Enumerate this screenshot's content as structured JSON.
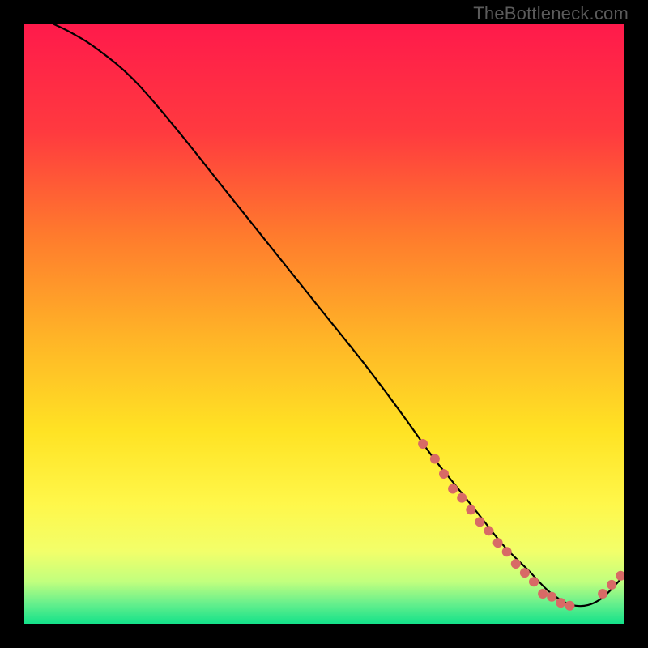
{
  "watermark": "TheBottleneck.com",
  "chart_data": {
    "type": "line",
    "title": "",
    "xlabel": "",
    "ylabel": "",
    "xlim": [
      0,
      100
    ],
    "ylim": [
      0,
      100
    ],
    "series": [
      {
        "name": "curve",
        "x": [
          5,
          8,
          12,
          18,
          25,
          33,
          41,
          49,
          57,
          63,
          68,
          72,
          76,
          80,
          84,
          88,
          92,
          96,
          100
        ],
        "y": [
          100,
          98.5,
          96,
          91,
          83,
          73,
          63,
          53,
          43,
          35,
          28,
          23,
          18,
          13,
          9,
          5,
          3,
          4,
          8
        ]
      }
    ],
    "markers": {
      "name": "dots",
      "x": [
        66.5,
        68.5,
        70,
        71.5,
        73,
        74.5,
        76,
        77.5,
        79,
        80.5,
        82,
        83.5,
        85,
        86.5,
        88,
        89.5,
        91,
        96.5,
        98,
        99.5
      ],
      "y": [
        30,
        27.5,
        25,
        22.5,
        21,
        19,
        17,
        15.5,
        13.5,
        12,
        10,
        8.5,
        7,
        5,
        4.5,
        3.5,
        3,
        5,
        6.5,
        8
      ]
    },
    "gradient_stops": [
      {
        "offset": 0.0,
        "color": "#ff1a4b"
      },
      {
        "offset": 0.18,
        "color": "#ff3a3f"
      },
      {
        "offset": 0.35,
        "color": "#ff7a2d"
      },
      {
        "offset": 0.52,
        "color": "#ffb327"
      },
      {
        "offset": 0.68,
        "color": "#ffe324"
      },
      {
        "offset": 0.8,
        "color": "#fff74a"
      },
      {
        "offset": 0.88,
        "color": "#f2ff6a"
      },
      {
        "offset": 0.93,
        "color": "#c1ff7e"
      },
      {
        "offset": 0.965,
        "color": "#6af08c"
      },
      {
        "offset": 1.0,
        "color": "#14e28a"
      }
    ],
    "curve_color": "#000000",
    "marker_color": "#d86a66",
    "marker_radius_px": 6
  }
}
